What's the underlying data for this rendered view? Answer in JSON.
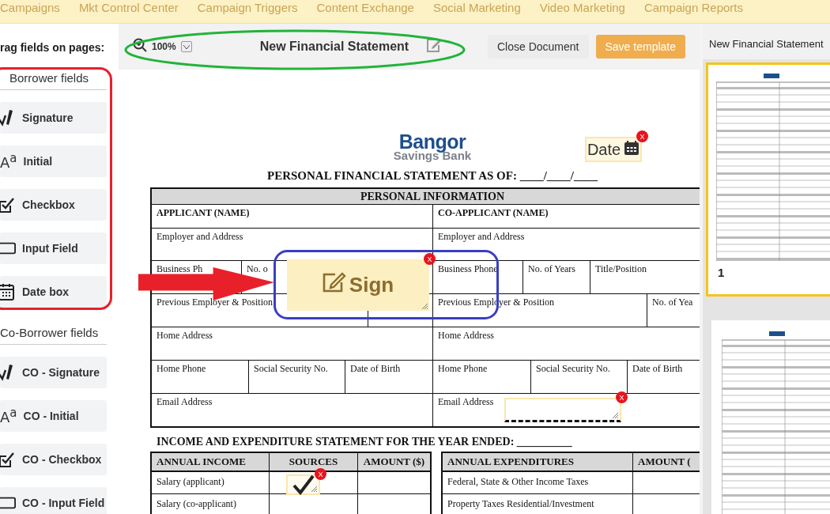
{
  "nav": {
    "items": [
      "Campaigns",
      "Mkt Control Center",
      "Campaign Triggers",
      "Content Exchange",
      "Social Marketing",
      "Video Marketing",
      "Campaign Reports"
    ]
  },
  "sidebar": {
    "heading": "rag fields on pages:",
    "groups": [
      {
        "title": "Borrower fields",
        "items": [
          {
            "label": "Signature",
            "kind": "signature"
          },
          {
            "label": "Initial",
            "kind": "initial",
            "icon_text": "A$^{a}$"
          },
          {
            "label": "Checkbox",
            "kind": "checkbox"
          },
          {
            "label": "Input Field",
            "kind": "input"
          },
          {
            "label": "Date box",
            "kind": "date"
          }
        ]
      },
      {
        "title": "Co-Borrower fields",
        "items": [
          {
            "label": "CO - Signature",
            "kind": "signature"
          },
          {
            "label": "CO - Initial",
            "kind": "initial",
            "icon_text": "A$^{a}$"
          },
          {
            "label": "CO - Checkbox",
            "kind": "checkbox"
          },
          {
            "label": "CO - Input Field",
            "kind": "input"
          }
        ]
      }
    ]
  },
  "toolbar": {
    "zoom": "100%",
    "title": "New Financial Statement",
    "buttons": [
      {
        "label": "Close Document",
        "kind": "secondary"
      },
      {
        "label": "Save template",
        "kind": "primary"
      }
    ]
  },
  "document": {
    "logo": {
      "name": "Bangor",
      "tagline": "Savings Bank"
    },
    "title": "PERSONAL FINANCIAL STATEMENT AS OF: ____/____/____",
    "personal_info": {
      "heading": "PERSONAL INFORMATION",
      "rows": [
        {
          "left": [
            "APPLICANT (NAME)"
          ],
          "right": [
            "CO-APPLICANT (NAME)"
          ]
        },
        {
          "left": [
            "Employer and Address"
          ],
          "right": [
            "Employer and Address"
          ]
        },
        {
          "left": [
            "Business Ph",
            "No. o"
          ],
          "right": [
            "Business Phone",
            "No. of Years",
            "Title/Position"
          ]
        },
        {
          "left": [
            "Previous Employer & Position"
          ],
          "right": [
            "Previous Employer & Position",
            "No. of Yea"
          ]
        },
        {
          "left": [
            "Home Address"
          ],
          "right": [
            "Home Address"
          ]
        },
        {
          "left": [
            "Home Phone",
            "Social Security No.",
            "Date of Birth"
          ],
          "right": [
            "Home Phone",
            "Social Security No.",
            "Date of Birth"
          ]
        },
        {
          "left": [
            "Email Address"
          ],
          "right": [
            "Email Address"
          ]
        }
      ]
    },
    "income_heading": "INCOME AND EXPENDITURE STATEMENT FOR THE YEAR ENDED: __________",
    "income_table": {
      "columns": [
        "ANNUAL INCOME",
        "SOURCES",
        "AMOUNT ($)"
      ],
      "rows": [
        [
          "Salary (applicant)"
        ],
        [
          "Salary (co-applicant)"
        ]
      ]
    },
    "expenditure_table": {
      "columns": [
        "ANNUAL EXPENDITURES",
        "AMOUNT ("
      ],
      "rows": [
        [
          "Federal, State & Other Income Taxes"
        ],
        [
          "Property Taxes Residential/Investment"
        ]
      ]
    }
  },
  "placed_fields": [
    {
      "kind": "date",
      "label": "Date",
      "remove": "X"
    },
    {
      "kind": "signature",
      "label": "Sign",
      "remove": "X"
    },
    {
      "kind": "input",
      "remove": "X"
    },
    {
      "kind": "checkbox",
      "checked": true,
      "remove": "X"
    }
  ],
  "annotations": [
    {
      "kind": "rounded_rect",
      "color": "#e8202a"
    },
    {
      "kind": "arrow",
      "color": "#e8202a"
    },
    {
      "kind": "ellipse",
      "color": "#22b33a"
    },
    {
      "kind": "rounded_rect",
      "color": "#3a3fc0"
    }
  ],
  "pages_panel": {
    "title": "New Financial Statement",
    "pages": [
      {
        "number": "1",
        "selected": true
      },
      {
        "selected": false
      }
    ]
  }
}
